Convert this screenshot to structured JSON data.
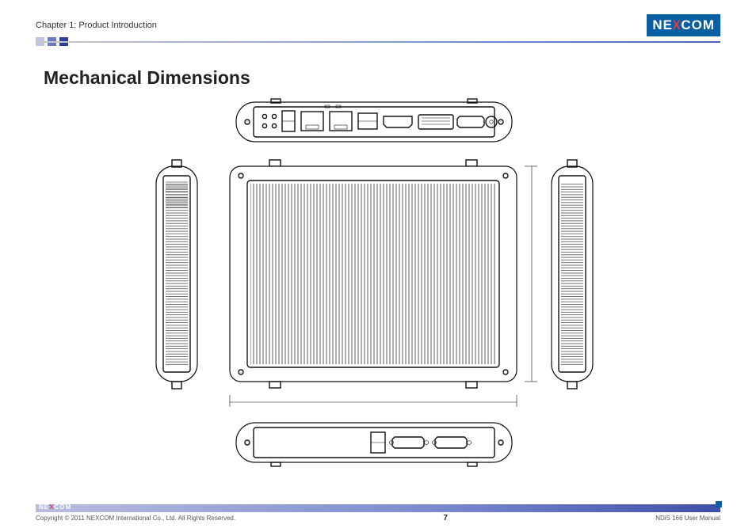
{
  "header": {
    "chapter": "Chapter 1: Product Introduction",
    "brand": "NEXCOM"
  },
  "section": {
    "title": "Mechanical Dimensions"
  },
  "footer": {
    "brand": "NEXCOM",
    "copyright": "Copyright © 2011 NEXCOM International Co., Ltd. All Rights Reserved.",
    "page": "7",
    "doc": "NDiS 166 User Manual"
  },
  "diagram": {
    "views": [
      "rear",
      "left",
      "top",
      "right",
      "front"
    ],
    "description": "Five orthographic views of an industrial embedded PC enclosure showing mechanical dimensions: rear I/O panel (LAN, USB, HDMI, DVI, VGA, DC-in), left side with ventilation fins, top cover with cooling fins, right side with ventilation fins, and front panel with USB and two serial ports."
  }
}
